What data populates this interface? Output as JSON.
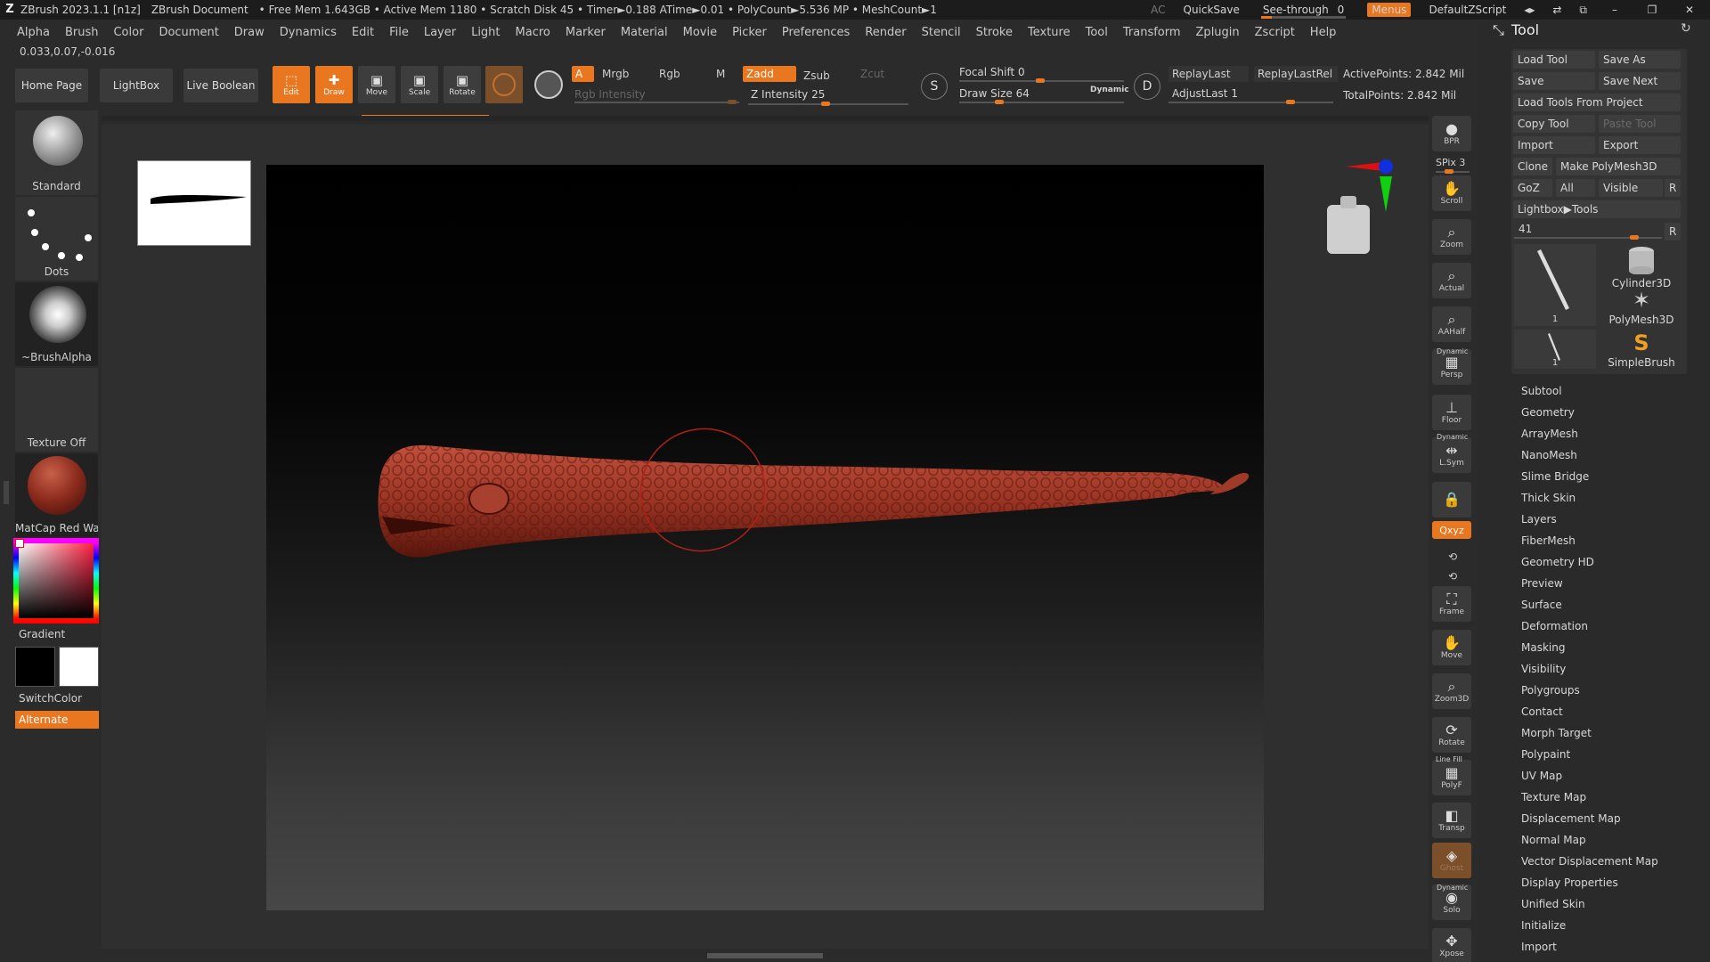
{
  "titlebar": {
    "app": "ZBrush 2023.1.1 [n1z]",
    "document": "ZBrush Document",
    "status": "• Free Mem 1.643GB • Active Mem 1180 • Scratch Disk 45 •  Timer►0.188 ATime►0.01 • PolyCount►5.536 MP  • MeshCount►1",
    "ac": "AC",
    "quicksave": "QuickSave",
    "seethrough_label": "See-through",
    "seethrough_value": "0",
    "seethrough_fraction": 0,
    "menus": "Menus",
    "defaultzscript": "DefaultZScript",
    "accent": "#e8771f"
  },
  "menubar": [
    "Alpha",
    "Brush",
    "Color",
    "Document",
    "Draw",
    "Dynamics",
    "Edit",
    "File",
    "Layer",
    "Light",
    "Macro",
    "Marker",
    "Material",
    "Movie",
    "Picker",
    "Preferences",
    "Render",
    "Stencil",
    "Stroke",
    "Texture",
    "Tool",
    "Transform",
    "Zplugin",
    "Zscript",
    "Help"
  ],
  "coords": "0.033,0.07,-0.016",
  "toolbar": {
    "home": "Home Page",
    "lightbox": "LightBox",
    "liveboolean": "Live Boolean",
    "edit": "Edit",
    "draw": "Draw",
    "move": "Move",
    "scale": "Scale",
    "rotate": "Rotate",
    "a": "A",
    "mrgb": "Mrgb",
    "rgb": "Rgb",
    "m": "M",
    "zadd": "Zadd",
    "zsub": "Zsub",
    "zcut": "Zcut",
    "rgb_intensity": "Rgb Intensity",
    "z_intensity": "Z Intensity 25",
    "z_intensity_value": 25,
    "focal_shift": "Focal Shift 0",
    "draw_size": "Draw Size 64",
    "dynamic": "Dynamic",
    "replaylast": "ReplayLast",
    "replaylastrel": "ReplayLastRel",
    "adjustlast": "AdjustLast 1",
    "activepoints": "ActivePoints: 2.842 Mil",
    "totalpoints": "TotalPoints: 2.842 Mil",
    "s": "S",
    "d": "D"
  },
  "leftshelf": {
    "brush": "Standard",
    "stroke": "Dots",
    "alpha": "~BrushAlpha",
    "texture": "Texture Off",
    "material": "MatCap Red Wax",
    "gradient": "Gradient",
    "switchcolor": "SwitchColor",
    "alternate": "Alternate"
  },
  "righttools": [
    {
      "name": "bpr",
      "label": "BPR",
      "icon": "sphere-icon"
    },
    {
      "name": "scroll",
      "label": "Scroll",
      "icon": "hand-icon"
    },
    {
      "name": "zoom",
      "label": "Zoom",
      "icon": "magnifier-icon"
    },
    {
      "name": "actual",
      "label": "Actual",
      "icon": "magnifier-icon"
    },
    {
      "name": "aahalf",
      "label": "AAHalf",
      "icon": "magnifier-icon"
    },
    {
      "name": "persp",
      "label": "Persp",
      "icon": "grid-icon"
    },
    {
      "name": "floor",
      "label": "Floor",
      "icon": "floor-icon"
    },
    {
      "name": "lsym",
      "label": "L.Sym",
      "icon": "arrows-icon"
    },
    {
      "name": "lock",
      "label": "",
      "icon": "lock-icon"
    },
    {
      "name": "xyz",
      "label": "Qxyz",
      "icon": "xyz-icon"
    },
    {
      "name": "frame",
      "label": "Frame",
      "icon": "frame-icon"
    },
    {
      "name": "move",
      "label": "Move",
      "icon": "hand-icon"
    },
    {
      "name": "zoom3d",
      "label": "Zoom3D",
      "icon": "magnifier-icon"
    },
    {
      "name": "rotate",
      "label": "Rotate",
      "icon": "rotate-icon"
    },
    {
      "name": "polyf",
      "label": "PolyF",
      "icon": "grid-icon"
    },
    {
      "name": "transp",
      "label": "Transp",
      "icon": "transp-icon"
    },
    {
      "name": "ghost",
      "label": "Ghost",
      "icon": "ghost-icon"
    },
    {
      "name": "solo",
      "label": "Solo",
      "icon": "solo-icon"
    },
    {
      "name": "xpose",
      "label": "Xpose",
      "icon": "xpose-icon"
    }
  ],
  "righttool_extras": {
    "spix": "SPix 3",
    "dynamic_persp": "Dynamic",
    "dynamic_lsym": "Dynamic",
    "linefill": "Line Fill",
    "dynamic_solo": "Dynamic"
  },
  "toolpanel": {
    "title": "Tool",
    "load_tool": "Load Tool",
    "save_as": "Save As",
    "save": "Save",
    "save_next": "Save Next",
    "load_from_project": "Load Tools From Project",
    "copy_tool": "Copy Tool",
    "paste_tool": "Paste Tool",
    "import": "Import",
    "export": "Export",
    "clone": "Clone",
    "make_polymesh": "Make PolyMesh3D",
    "goz": "GoZ",
    "all": "All",
    "visible": "Visible",
    "r": "R",
    "lightbox_tools": "Lightbox▶Tools",
    "tool_count": "41",
    "r2": "R",
    "thumb_count_1": "1",
    "thumb_count_2": "1",
    "cylinder": "Cylinder3D",
    "polymesh": "PolyMesh3D",
    "simplebrush": "SimpleBrush",
    "subpalettes": [
      "Subtool",
      "Geometry",
      "ArrayMesh",
      "NanoMesh",
      "Slime Bridge",
      "Thick Skin",
      "Layers",
      "FiberMesh",
      "Geometry HD",
      "Preview",
      "Surface",
      "Deformation",
      "Masking",
      "Visibility",
      "Polygroups",
      "Contact",
      "Morph Target",
      "Polypaint",
      "UV Map",
      "Texture Map",
      "Displacement Map",
      "Normal Map",
      "Vector Displacement Map",
      "Display Properties",
      "Unified Skin",
      "Initialize",
      "Import"
    ]
  }
}
